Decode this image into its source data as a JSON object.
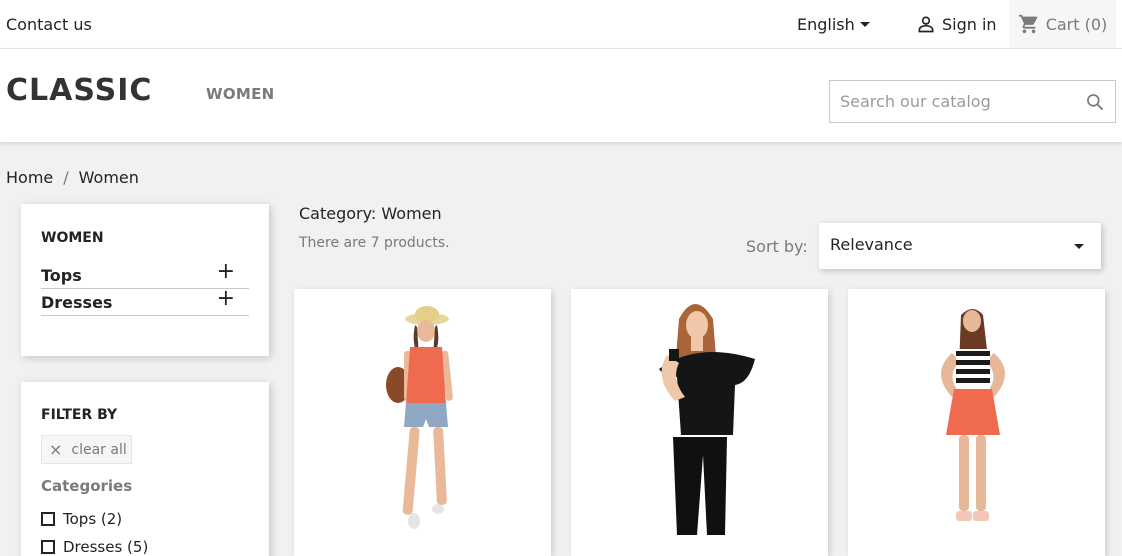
{
  "topbar": {
    "contact": "Contact us",
    "language": "English",
    "signin": "Sign in",
    "cart": "Cart (0)"
  },
  "header": {
    "logo": "CLASSIC",
    "menu": [
      "WOMEN"
    ],
    "search_placeholder": "Search our catalog"
  },
  "breadcrumb": [
    "Home",
    "Women"
  ],
  "sidebar": {
    "category_title": "WOMEN",
    "categories": [
      {
        "label": "Tops",
        "toggle": "+"
      },
      {
        "label": "Dresses",
        "toggle": "+"
      }
    ],
    "filter": {
      "title": "FILTER BY",
      "clear_icon": "×",
      "clear_label": "clear all",
      "facet_title": "Categories",
      "items": [
        "Tops (2)",
        "Dresses (5)"
      ]
    }
  },
  "main": {
    "heading": "Category: Women",
    "product_count": "There are 7 products.",
    "sort_label": "Sort by:",
    "sort_value": "Relevance"
  },
  "products": [
    {
      "image": "woman-straw-hat-orange-top-denim-shorts"
    },
    {
      "image": "woman-black-ruffle-top-black-pants"
    },
    {
      "image": "woman-striped-top-orange-skirt"
    }
  ],
  "colors": {
    "background": "#f1f1f1",
    "text": "#232323",
    "muted": "#7a7a7a",
    "accent_orange": "#f06a4f"
  },
  "icons": {
    "language_caret": "chevron-down-icon",
    "signin": "user-icon",
    "cart": "cart-icon",
    "search": "search-icon",
    "sort_caret": "chevron-down-icon"
  }
}
